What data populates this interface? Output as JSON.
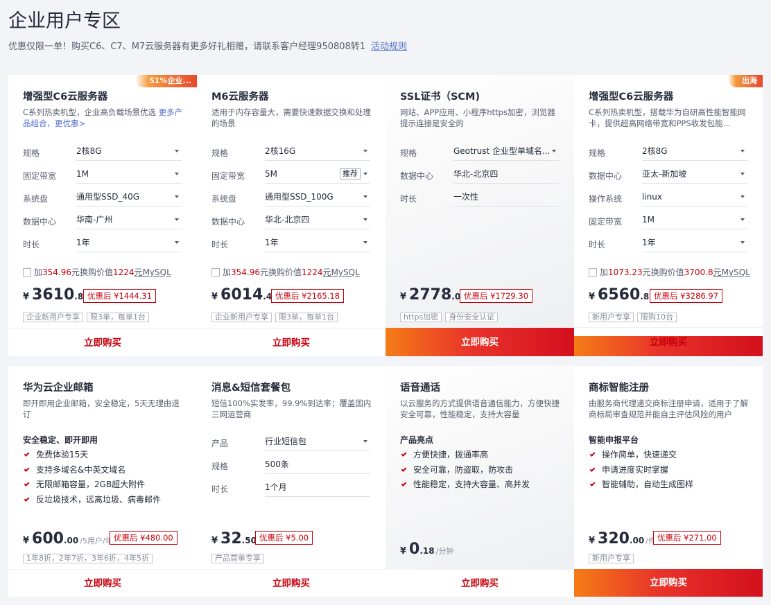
{
  "header": {
    "title": "企业用户专区",
    "subtitle": "优惠仅限一单！购买C6、C7、M7云服务器有更多好礼相赠，请联系客户经理950808转1",
    "rules_link": "活动规则"
  },
  "row1": {
    "c6": {
      "badge": "51%企业...",
      "name": "增强型C6云服务器",
      "desc": "C系列热卖机型，企业高负载场景优选",
      "desc_link": "更多产品组合，更优惠>",
      "fields": [
        {
          "label": "规格",
          "value": "2核8G"
        },
        {
          "label": "固定带宽",
          "value": "1M"
        },
        {
          "label": "系统盘",
          "value": "通用型SSD_40G"
        },
        {
          "label": "数据中心",
          "value": "华南-广州"
        },
        {
          "label": "时长",
          "value": "1年"
        }
      ],
      "addon": {
        "pre": "加",
        "price": "354.96",
        "mid": "元换购价值",
        "value": "1224",
        "post": "元MySQL"
      },
      "price": {
        "currency": "¥",
        "int": "3610",
        "dec": ".80"
      },
      "discount": "优惠后 ¥1444.31",
      "tags": [
        "企业新用户专享",
        "限3单，每单1台"
      ],
      "buy": "立即购买"
    },
    "m6": {
      "name": "M6云服务器",
      "desc": "适用于内存容量大，需要快速数据交换和处理的场景",
      "fields": [
        {
          "label": "规格",
          "value": "2核16G"
        },
        {
          "label": "固定带宽",
          "value": "5M",
          "tag": "推荐"
        },
        {
          "label": "系统盘",
          "value": "通用型SSD_100G"
        },
        {
          "label": "数据中心",
          "value": "华北-北京四"
        },
        {
          "label": "时长",
          "value": "1年"
        }
      ],
      "addon": {
        "pre": "加",
        "price": "354.96",
        "mid": "元换购价值",
        "value": "1224",
        "post": "元MySQL"
      },
      "price": {
        "currency": "¥",
        "int": "6014",
        "dec": ".40"
      },
      "discount": "优惠后 ¥2165.18",
      "tags": [
        "企业新用户专享",
        "限3单，每单1台"
      ],
      "buy": "立即购买"
    },
    "ssl": {
      "name": "SSL证书（SCM)",
      "desc": "网站、APP应用、小程序https加密，浏览器提示连接是安全的",
      "fields": [
        {
          "label": "规格",
          "value": "Geotrust 企业型单域名..."
        },
        {
          "label": "数据中心",
          "value": "华北-北京四"
        },
        {
          "label": "时长",
          "value": "一次性"
        }
      ],
      "price": {
        "currency": "¥",
        "int": "2778",
        "dec": ".00"
      },
      "discount": "优惠后 ¥1729.30",
      "tags": [
        "https加密",
        "身份安全认证"
      ],
      "buy": "立即购买"
    },
    "c6sea": {
      "badge": "出海",
      "name": "增强型C6云服务器",
      "desc": "C系列热卖机型，搭载华为自研高性能智能网卡，提供超高网络带宽和PPS收发包能...",
      "fields": [
        {
          "label": "规格",
          "value": "2核8G"
        },
        {
          "label": "数据中心",
          "value": "亚太-新加坡"
        },
        {
          "label": "操作系统",
          "value": "linux"
        },
        {
          "label": "固定带宽",
          "value": "1M"
        },
        {
          "label": "时长",
          "value": "1年"
        }
      ],
      "addon": {
        "pre": "加",
        "price": "1073.23",
        "mid": "元换购价值",
        "value": "3700.8",
        "post": "元MySQL"
      },
      "price": {
        "currency": "¥",
        "int": "6560",
        "dec": ".85"
      },
      "discount": "优惠后 ¥3286.97",
      "tags": [
        "新用户专享",
        "限购10台"
      ],
      "buy": "立即购买"
    }
  },
  "row2": {
    "mail": {
      "name": "华为云企业邮箱",
      "desc": "即开即用企业邮箱，安全稳定，5天无理由退订",
      "feat_title": "安全稳定、即开即用",
      "features": [
        "免费体验15天",
        "支持多域名&中英文域名",
        "无限邮箱容量，2GB超大附件",
        "反垃圾技术，远离垃圾、病毒邮件"
      ],
      "price": {
        "currency": "¥",
        "int": "600",
        "dec": ".00",
        "unit": "/5用户/年"
      },
      "discount": "优惠后 ¥480.00",
      "tags": [
        "1年8折，2年7折，3年6折，4年5折"
      ],
      "buy": "立即购买"
    },
    "sms": {
      "name": "消息&短信套餐包",
      "desc": "短信100%实发率，99.9%到达率；覆盖国内三网运营商",
      "fields": [
        {
          "label": "产品",
          "value": "行业短信包"
        },
        {
          "label": "规格",
          "value": "500条"
        },
        {
          "label": "时长",
          "value": "1个月"
        }
      ],
      "price": {
        "currency": "¥",
        "int": "32",
        "dec": ".50"
      },
      "discount": "优惠后 ¥5.00",
      "tags": [
        "产品首单专享"
      ],
      "buy": "立即购买"
    },
    "voice": {
      "name": "语音通话",
      "desc": "以云服务的方式提供语音通信能力，方便快捷安全可靠，性能稳定，支持大容量",
      "feat_title": "产品亮点",
      "features": [
        "方便快捷，拨通率高",
        "安全可靠，防盗取，防攻击",
        "性能稳定，支持大容量、高并发"
      ],
      "price": {
        "currency": "¥",
        "int": "0",
        "dec": ".18",
        "unit": "/分钟"
      },
      "buy": "立即购买"
    },
    "tm": {
      "name": "商标智能注册",
      "desc": "由服务商代理递交商标注册申请，适用于了解商标局审查规范并能自主评估风险的用户",
      "feat_title": "智能申报平台",
      "features": [
        "操作简单，快速递交",
        "申请进度实时掌握",
        "智能辅助，自动生成图样"
      ],
      "price": {
        "currency": "¥",
        "int": "320",
        "dec": ".00",
        "unit": "/件"
      },
      "discount": "优惠后 ¥271.00",
      "tags": [
        "新用户专享"
      ],
      "buy": "立即购买"
    }
  }
}
